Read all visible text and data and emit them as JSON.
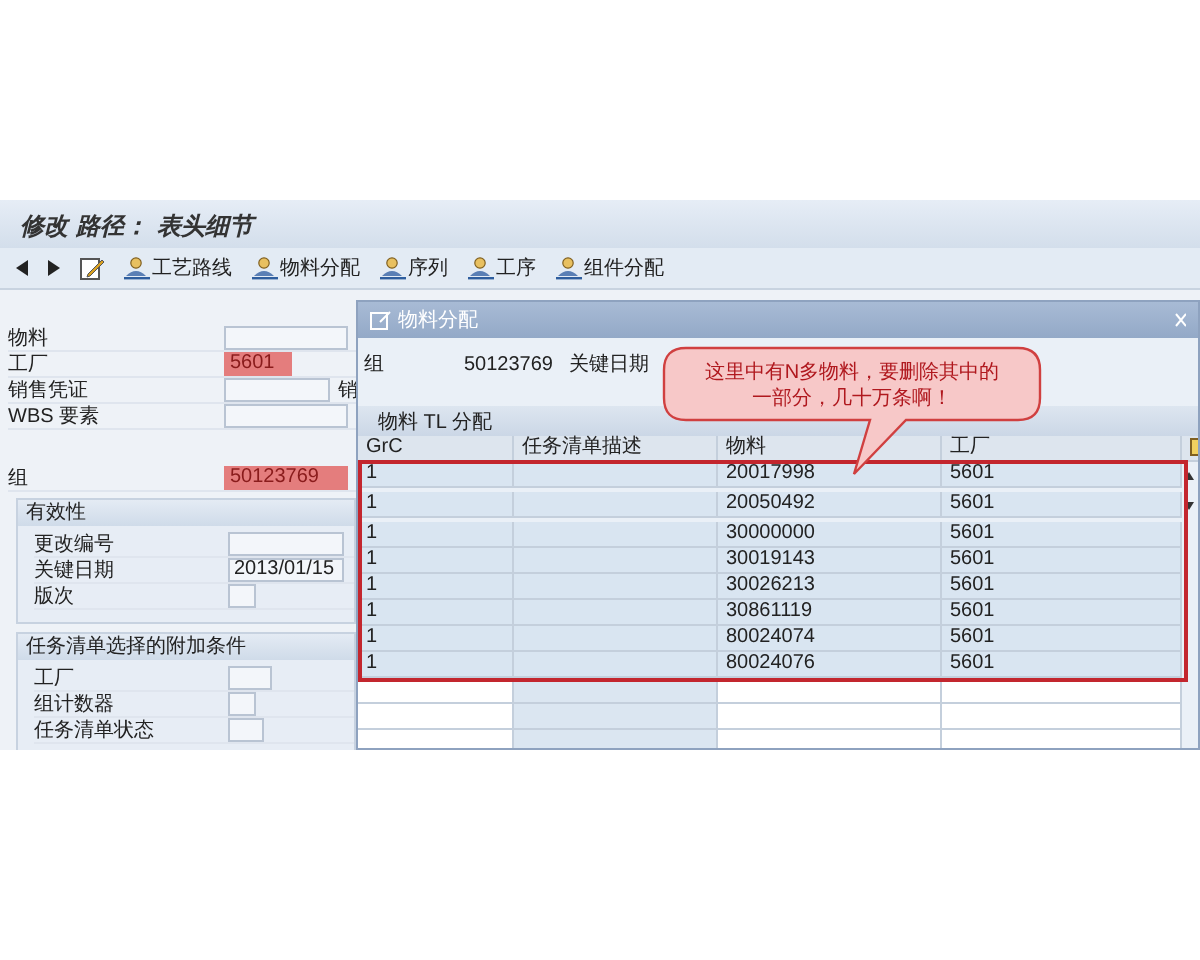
{
  "title": "修改 路径： 表头细节",
  "toolbar": [
    {
      "label": "工艺路线"
    },
    {
      "label": "物料分配"
    },
    {
      "label": "序列"
    },
    {
      "label": "工序"
    },
    {
      "label": "组件分配"
    }
  ],
  "header_fields": [
    {
      "label": "物料",
      "highlighted": false
    },
    {
      "label": "工厂",
      "value": "5601",
      "highlighted": true
    },
    {
      "label": "销售凭证",
      "highlighted": false,
      "side_label": "销"
    },
    {
      "label": "WBS 要素",
      "highlighted": false
    },
    {
      "label": "组",
      "value": "50123769",
      "highlighted": true
    }
  ],
  "validity": {
    "title": "有效性",
    "fields": [
      {
        "label": "更改编号"
      },
      {
        "label": "关键日期",
        "value": "2013/01/15"
      },
      {
        "label": "版次"
      }
    ]
  },
  "conditions": {
    "title": "任务清单选择的附加条件",
    "fields": [
      {
        "label": "工厂"
      },
      {
        "label": "组计数器"
      },
      {
        "label": "任务清单状态"
      }
    ]
  },
  "dialog": {
    "title": "物料分配",
    "group_label": "组",
    "group_value": "50123769",
    "key_date_label": "关键日期",
    "section": "物料 TL 分配",
    "columns": [
      "GrC",
      "任务清单描述",
      "物料",
      "工厂"
    ],
    "rows": [
      {
        "grc": "1",
        "material": "20017998",
        "plant": "5601",
        "selected": true
      },
      {
        "grc": "1",
        "material": "20050492",
        "plant": "5601",
        "selected": true
      },
      {
        "grc": "1",
        "material": "30000000",
        "plant": "5601",
        "selected": true
      },
      {
        "grc": "1",
        "material": "30019143",
        "plant": "5601",
        "selected": true
      },
      {
        "grc": "1",
        "material": "30026213",
        "plant": "5601",
        "selected": true
      },
      {
        "grc": "1",
        "material": "30861119",
        "plant": "5601",
        "selected": true
      },
      {
        "grc": "1",
        "material": "80024074",
        "plant": "5601",
        "selected": true
      },
      {
        "grc": "1",
        "material": "80024076",
        "plant": "5601",
        "selected": true
      }
    ]
  },
  "callout": {
    "lines": [
      "这里中有N多物料，要删除其中的",
      "一部分，几十万条啊！"
    ]
  }
}
